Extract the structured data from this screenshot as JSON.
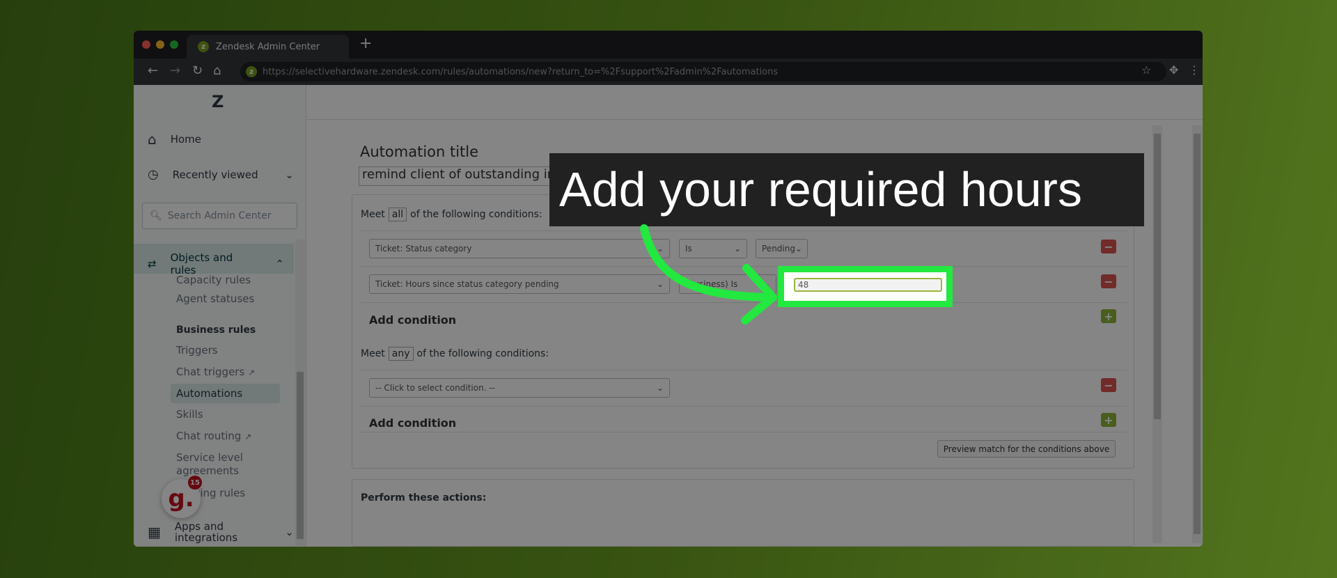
{
  "browser": {
    "tab_title": "Zendesk Admin Center",
    "url": "https://selectivehardware.zendesk.com/rules/automations/new?return_to=%2Fsupport%2Fadmin%2Fautomations"
  },
  "sidebar": {
    "home": "Home",
    "recently_viewed": "Recently viewed",
    "search_placeholder": "Search Admin Center",
    "objects_and_rules": "Objects and rules",
    "items": [
      "Capacity rules",
      "Agent statuses"
    ],
    "business_rules": "Business rules",
    "business_items": [
      "Triggers",
      "Chat triggers",
      "Automations",
      "Skills",
      "Chat routing",
      "Service level agreements",
      "Routing rules"
    ],
    "apps": "Apps and integrations",
    "badge_count": "15"
  },
  "main": {
    "title_label": "Automation title",
    "title_value": "remind client of outstanding information required",
    "all": {
      "meet": "Meet",
      "qualifier": "all",
      "rest": "of the following conditions:",
      "rows": [
        {
          "field": "Ticket: Status category",
          "operator": "Is",
          "value": "Pending"
        },
        {
          "field": "Ticket: Hours since status category pending",
          "operator": "(business) Is",
          "value": "48"
        }
      ]
    },
    "add_condition": "Add condition",
    "any": {
      "meet": "Meet",
      "qualifier": "any",
      "rest": "of the following conditions:",
      "rows": [
        {
          "field": "-- Click to select condition. --"
        }
      ]
    },
    "preview": "Preview match for the conditions above",
    "actions": "Perform these actions:"
  },
  "callout": {
    "text": "Add your required hours",
    "highlight_color": "#22e840"
  }
}
